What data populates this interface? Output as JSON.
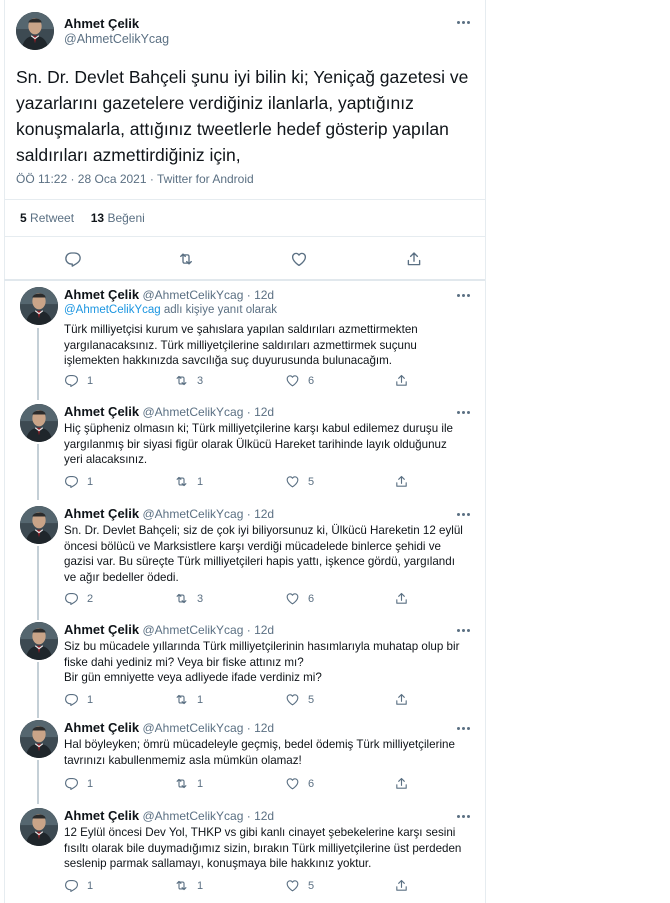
{
  "main_tweet": {
    "author_name": "Ahmet Çelik",
    "author_handle": "@AhmetCelikYcag",
    "text": "Sn. Dr. Devlet Bahçeli şunu iyi bilin ki; Yeniçağ gazetesi ve yazarlarını gazetelere verdiğiniz ilanlarla, yaptığınız konuşmalarla, attığınız tweetlerle hedef gösterip yapılan saldırıları azmettirdiğiniz için,",
    "time": "ÖÖ 11:22 · 28 Oca 2021",
    "separator": " · ",
    "source": "Twitter for Android",
    "retweets_count": "5",
    "retweets_label": "Retweet",
    "likes_count": "13",
    "likes_label": "Beğeni"
  },
  "icons": {
    "reply": "reply-icon",
    "retweet": "retweet-icon",
    "like": "heart-icon",
    "share": "share-icon",
    "more": "more-icon"
  },
  "colors": {
    "link": "#1b95e0",
    "muted": "#5b7083",
    "thread_line": "#c4cfd6",
    "divider": "#e6ecf0"
  },
  "replies": [
    {
      "author_name": "Ahmet Çelik",
      "author_handle": "@AhmetCelikYcag",
      "time": "12d",
      "replying_to_handle": "@AhmetCelikYcag",
      "replying_to_suffix": "adlı kişiye yanıt olarak",
      "text": "Türk milliyetçisi kurum ve şahıslara yapılan saldırıları azmettirmekten yargılanacaksınız. Türk milliyetçilerine saldırıları azmettirmek suçunu işlemekten hakkınızda savcılığa suç duyurusunda bulunacağım.",
      "replies": "1",
      "retweets": "3",
      "likes": "6"
    },
    {
      "author_name": "Ahmet Çelik",
      "author_handle": "@AhmetCelikYcag",
      "time": "12d",
      "text": "Hiç şüpheniz olmasın ki; Türk milliyetçilerine karşı kabul edilemez duruşu ile yargılanmış bir siyasi figür olarak Ülkücü Hareket tarihinde layık olduğunuz yeri alacaksınız.",
      "replies": "1",
      "retweets": "1",
      "likes": "5"
    },
    {
      "author_name": "Ahmet Çelik",
      "author_handle": "@AhmetCelikYcag",
      "time": "12d",
      "text": "Sn. Dr. Devlet Bahçeli; siz de çok iyi biliyorsunuz ki, Ülkücü Hareketin 12 eylül öncesi bölücü ve Marksistlere karşı verdiği mücadelede binlerce şehidi ve gazisi var. Bu süreçte Türk milliyetçileri hapis yattı, işkence gördü, yargılandı ve ağır bedeller ödedi.",
      "replies": "2",
      "retweets": "3",
      "likes": "6"
    },
    {
      "author_name": "Ahmet Çelik",
      "author_handle": "@AhmetCelikYcag",
      "time": "12d",
      "text": "Siz bu mücadele yıllarında Türk milliyetçilerinin hasımlarıyla muhatap olup bir fiske dahi yediniz mi? Veya bir fiske attınız mı?\nBir gün emniyette veya adliyede ifade verdiniz mi?",
      "replies": "1",
      "retweets": "1",
      "likes": "5"
    },
    {
      "author_name": "Ahmet Çelik",
      "author_handle": "@AhmetCelikYcag",
      "time": "12d",
      "text": "Hal böyleyken; ömrü mücadeleyle geçmiş, bedel ödemiş Türk milliyetçilerine tavrınızı kabullenmemiz asla mümkün olamaz!",
      "replies": "1",
      "retweets": "1",
      "likes": "6"
    },
    {
      "author_name": "Ahmet Çelik",
      "author_handle": "@AhmetCelikYcag",
      "time": "12d",
      "text": "12 Eylül öncesi Dev Yol, THKP vs gibi kanlı cinayet şebekelerine karşı sesini fısıltı olarak bile duymadığımız sizin, bırakın Türk milliyetçilerine üst perdeden seslenip parmak sallamayı, konuşmaya bile hakkınız yoktur.",
      "replies": "1",
      "retweets": "1",
      "likes": "5"
    }
  ]
}
